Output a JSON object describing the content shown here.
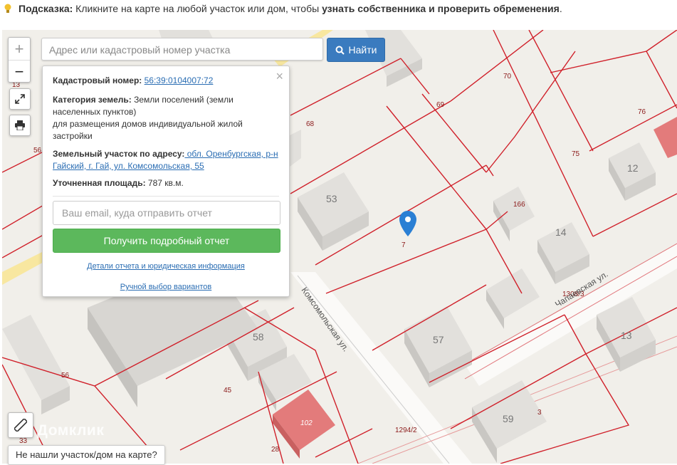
{
  "hint": {
    "prefix": "Подсказка:",
    "text": " Кликните на карте на любой участок или дом, чтобы ",
    "emphasis": "узнать собственника и проверить обременения",
    "suffix": "."
  },
  "controls": {
    "zoom_in": "+",
    "zoom_out": "−"
  },
  "search": {
    "placeholder": "Адрес или кадастровый номер участка",
    "button_label": "Найти"
  },
  "popup": {
    "close": "×",
    "cadastral_label": "Кадастровый номер:",
    "cadastral_number": "56:39:0104007:72",
    "category_label": "Категория земель:",
    "category_line1": " Земли поселений (земли",
    "category_line2": "населенных пунктов)",
    "category_line3": "для размещения домов индивидуальной жилой",
    "category_line4": "застройки",
    "address_label": "Земельный участок по адресу:",
    "address_line1": " обл. Оренбургская, р-н",
    "address_line2": "Гайский, г. Гай, ул. Комсомольская, 55",
    "area_label": "Уточненная площадь:",
    "area_value": " 787 кв.м.",
    "email_placeholder": "Ваш email, куда отправить отчет",
    "report_button": "Получить подробный отчет",
    "details_link": "Детали отчета и юридическая информация",
    "manual_link": "Ручной выбор вариантов"
  },
  "not_found": "Не нашли участок/дом на карте?",
  "watermark": "Домклик",
  "map": {
    "streets": [
      "Комсомольская ул.",
      "Чапаевская ул."
    ],
    "parcel_labels": [
      "13",
      "56",
      "68",
      "69",
      "70",
      "76",
      "75",
      "166",
      "7",
      "1308/3",
      "56",
      "45",
      "1294/2",
      "3",
      "28",
      "33"
    ],
    "building_numbers": [
      "53",
      "14",
      "12",
      "58",
      "57",
      "13",
      "59",
      "102"
    ]
  },
  "colors": {
    "parcel_line": "#d0202a",
    "building": "#dcdad6",
    "highlight_building": "#e37b7b",
    "marker": "#2a7fd4",
    "search_button": "#3a7bbf",
    "report_button": "#5cb85c"
  }
}
